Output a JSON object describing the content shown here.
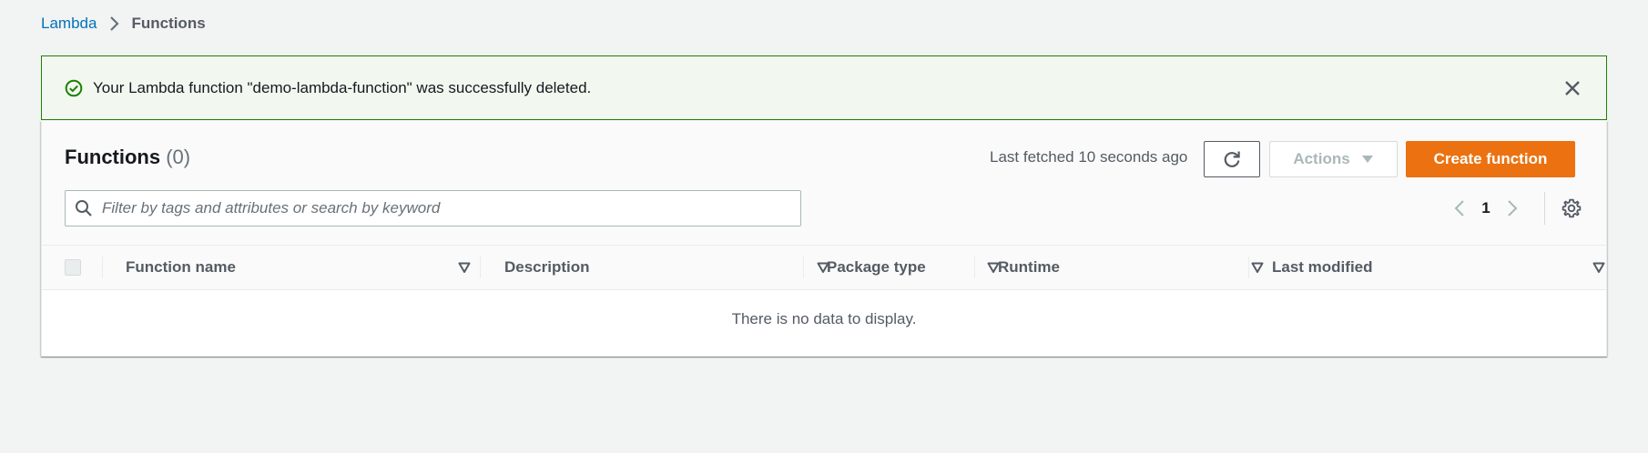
{
  "breadcrumb": {
    "root": "Lambda",
    "current": "Functions"
  },
  "flash": {
    "type": "success",
    "message": "Your Lambda function \"demo-lambda-function\" was successfully deleted.",
    "icon": "check-circle-icon",
    "close_icon": "close-icon"
  },
  "panel": {
    "title": "Functions",
    "count": "(0)",
    "last_fetched": "Last fetched 10 seconds ago",
    "refresh_icon": "refresh-icon",
    "actions_label": "Actions",
    "create_label": "Create function",
    "search_placeholder": "Filter by tags and attributes or search by keyword",
    "search_value": "",
    "page_number": "1"
  },
  "table": {
    "columns": [
      "Function name",
      "Description",
      "Package type",
      "Runtime",
      "Last modified"
    ],
    "rows": [],
    "empty_text": "There is no data to display."
  },
  "colors": {
    "link": "#0073bb",
    "success_border": "#1d8102",
    "success_bg": "#f2f8f0",
    "primary_button": "#ec7211",
    "page_bg": "#f2f3f3"
  }
}
